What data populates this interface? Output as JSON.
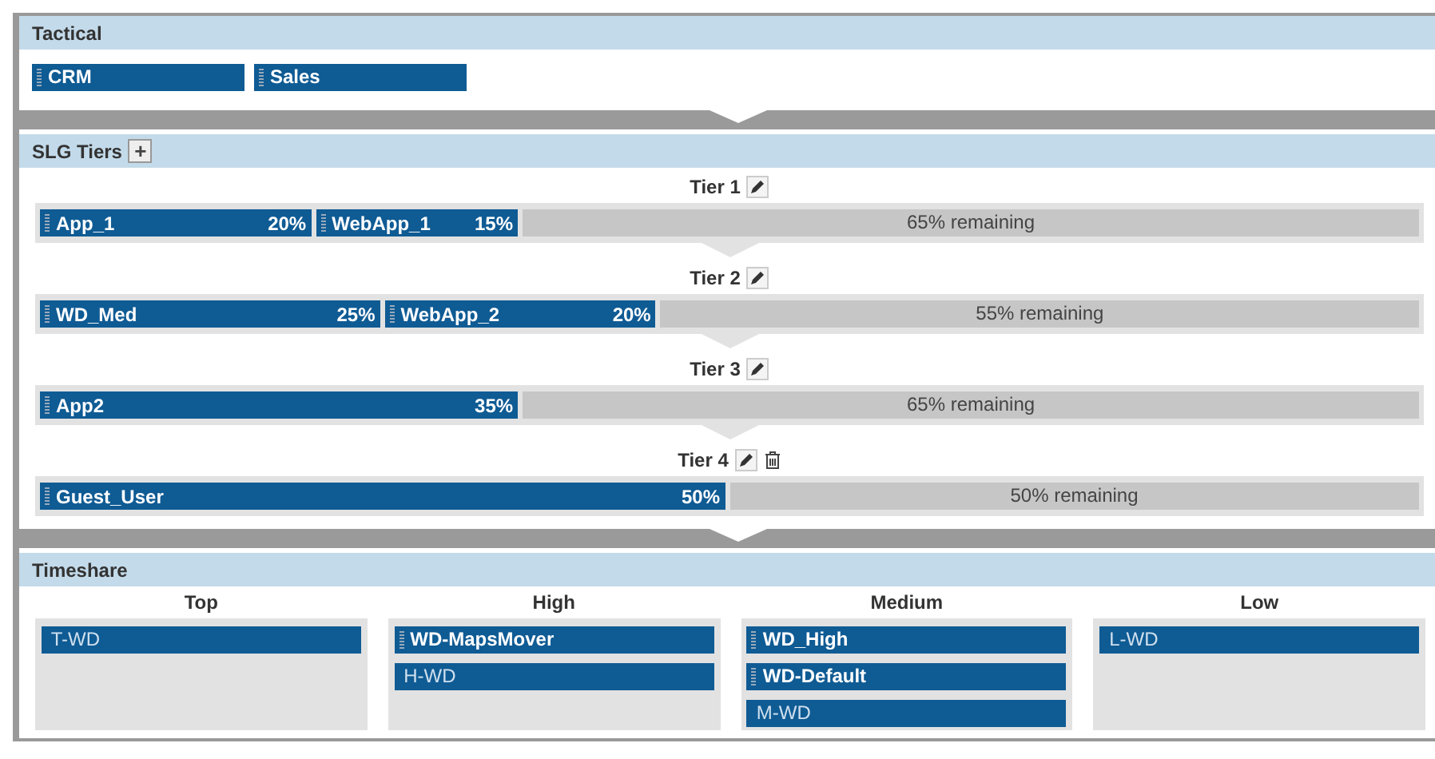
{
  "tactical": {
    "title": "Tactical",
    "items": [
      {
        "label": "CRM",
        "draggable": true
      },
      {
        "label": "Sales",
        "draggable": true
      }
    ]
  },
  "slg_tiers": {
    "title": "SLG Tiers",
    "add_button": "+",
    "tiers": [
      {
        "label": "Tier 1",
        "deletable": false,
        "items": [
          {
            "label": "App_1",
            "percent": "20%"
          },
          {
            "label": "WebApp_1",
            "percent": "15%"
          }
        ],
        "remaining": "65% remaining"
      },
      {
        "label": "Tier 2",
        "deletable": false,
        "items": [
          {
            "label": "WD_Med",
            "percent": "25%"
          },
          {
            "label": "WebApp_2",
            "percent": "20%"
          }
        ],
        "remaining": "55% remaining"
      },
      {
        "label": "Tier 3",
        "deletable": false,
        "items": [
          {
            "label": "App2",
            "percent": "35%"
          }
        ],
        "remaining": "65% remaining"
      },
      {
        "label": "Tier 4",
        "deletable": true,
        "items": [
          {
            "label": "Guest_User",
            "percent": "50%"
          }
        ],
        "remaining": "50% remaining"
      }
    ]
  },
  "timeshare": {
    "title": "Timeshare",
    "columns": [
      {
        "heading": "Top",
        "items": [
          {
            "label": "T-WD",
            "draggable": false
          }
        ]
      },
      {
        "heading": "High",
        "items": [
          {
            "label": "WD-MapsMover",
            "draggable": true
          },
          {
            "label": "H-WD",
            "draggable": false
          }
        ]
      },
      {
        "heading": "Medium",
        "items": [
          {
            "label": "WD_High",
            "draggable": true
          },
          {
            "label": "WD-Default",
            "draggable": true
          },
          {
            "label": "M-WD",
            "draggable": false
          }
        ]
      },
      {
        "heading": "Low",
        "items": [
          {
            "label": "L-WD",
            "draggable": false
          }
        ]
      }
    ]
  }
}
